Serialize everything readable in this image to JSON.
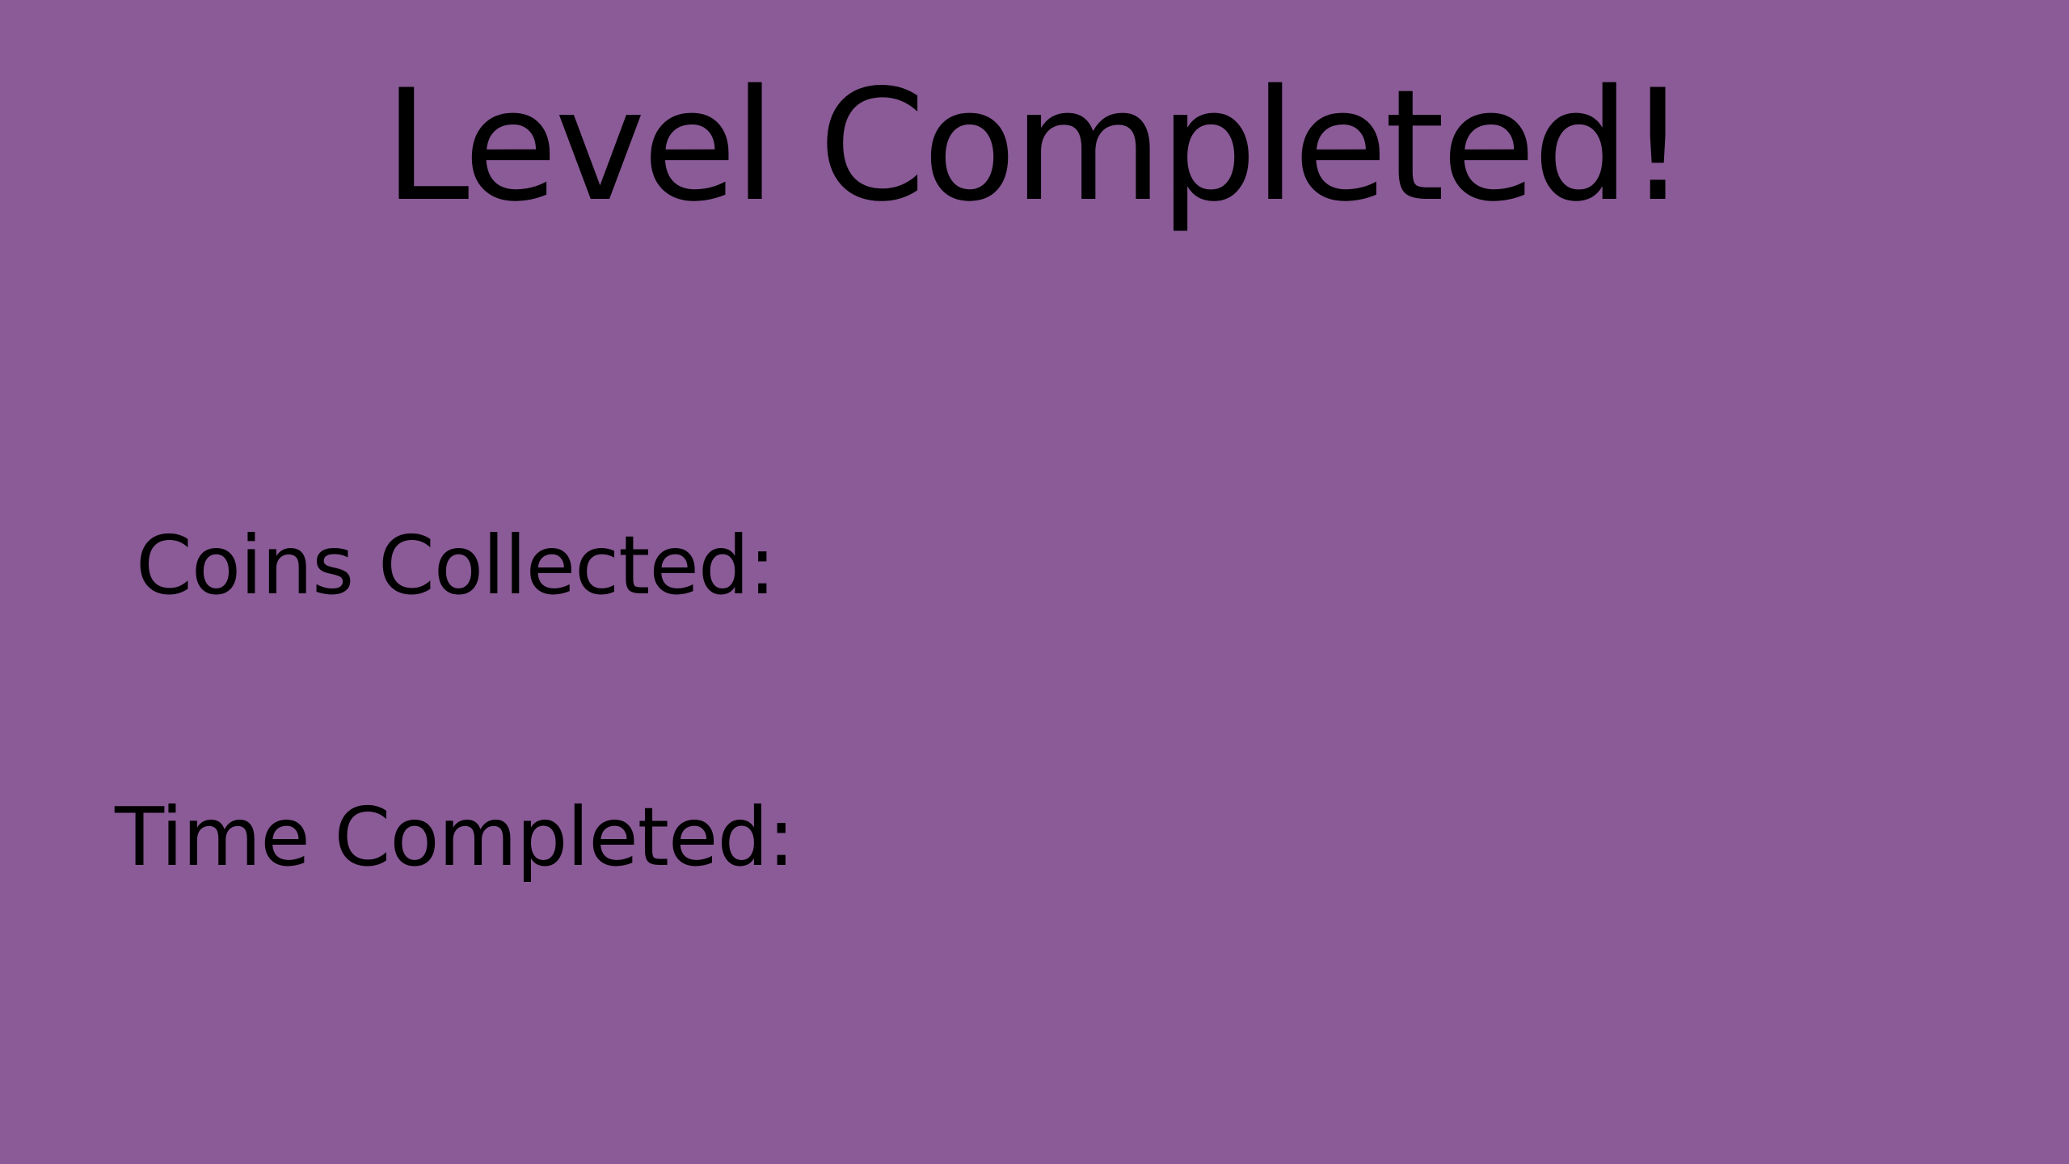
{
  "screen": {
    "title": "Level Completed!",
    "background_color": "#8a5b97",
    "text_color": "#000000"
  },
  "stats": {
    "coins_label": "Coins Collected:",
    "time_label": "Time Completed:"
  }
}
